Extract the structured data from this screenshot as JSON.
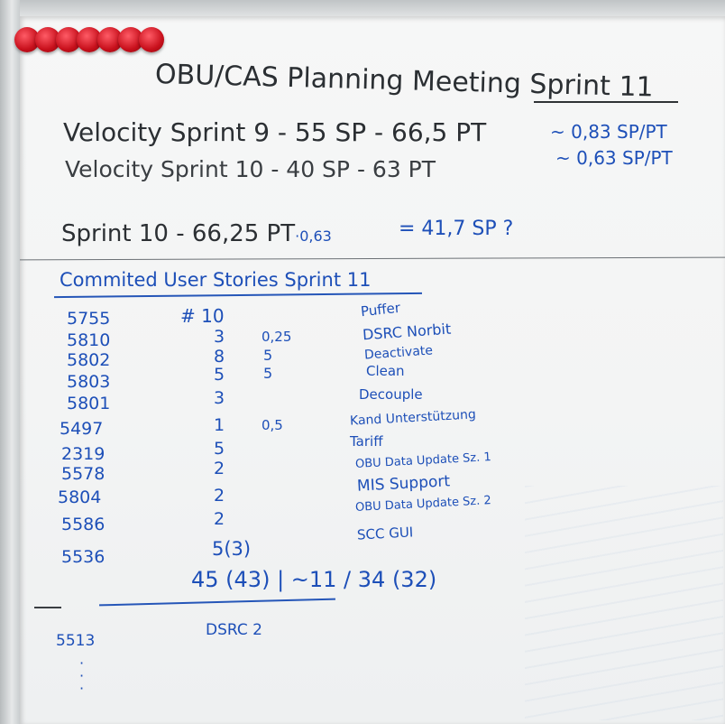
{
  "title": "OBU/CAS Planning Meeting Sprint 11",
  "velocity": [
    {
      "left": "Velocity Sprint 9 - 55 SP - 66,5 PT",
      "right": "~ 0,83 SP/PT"
    },
    {
      "left": "Velocity Sprint 10 - 40 SP - 63 PT",
      "right": "~ 0,63 SP/PT"
    }
  ],
  "forecast": {
    "left": "Sprint 10 - 66,25 PT",
    "factor": "·0,63",
    "right": "= 41,7 SP ?"
  },
  "section_heading": "Commited User Stories Sprint 11",
  "stories": [
    {
      "id": "5755",
      "points": "# 10",
      "extra": "",
      "name": "Puffer"
    },
    {
      "id": "5810",
      "points": "3",
      "extra": "0,25",
      "name": "DSRC Norbit"
    },
    {
      "id": "5802",
      "points": "8",
      "extra": "5",
      "name": "Deactivate"
    },
    {
      "id": "5803",
      "points": "5",
      "extra": "5",
      "name": "Clean"
    },
    {
      "id": "5801",
      "points": "3",
      "extra": "",
      "name": "Decouple"
    },
    {
      "id": "5497",
      "points": "1",
      "extra": "0,5",
      "name": "Kand Unterstützung"
    },
    {
      "id": "2319",
      "points": "5",
      "extra": "",
      "name": "Tariff"
    },
    {
      "id": "5578",
      "points": "2",
      "extra": "",
      "name": "OBU Data Update Sz. 1"
    },
    {
      "id": "5804",
      "points": "2",
      "extra": "",
      "name": "MIS Support"
    },
    {
      "id": "5586",
      "points": "2",
      "extra": "",
      "name": "OBU Data Update Sz. 2"
    },
    {
      "id": "5536",
      "points": "5(3)",
      "extra": "",
      "name": "SCC GUI"
    }
  ],
  "totals": "45 (43) | ~11 / 34 (32)",
  "extra_story": {
    "id": "5513",
    "name": "DSRC 2"
  },
  "colors": {
    "marker_black": "#2b2f33",
    "marker_blue": "#1d4fb8",
    "board": "#f5f6f6",
    "magnet": "#d0131f"
  },
  "magnets": 7
}
